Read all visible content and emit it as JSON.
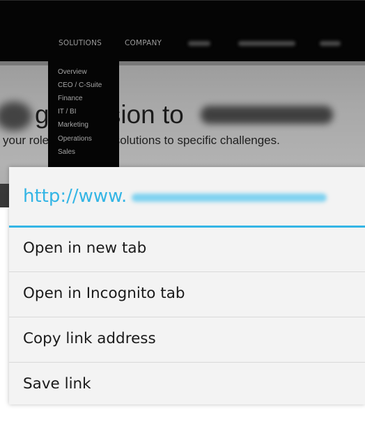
{
  "site": {
    "nav": {
      "solutions_label": "SOLUTIONS",
      "company_label": "COMPANY"
    },
    "dropdown_items": [
      "Overview",
      "CEO / C-Suite",
      "Finance",
      "IT / BI",
      "Marketing",
      "Operations",
      "Sales"
    ],
    "hero": {
      "heading": "give vision to",
      "subheading": "your role and unique solutions to specific challenges."
    }
  },
  "context_menu": {
    "url_prefix": "http://www.",
    "accent_color": "#33b5e5",
    "items": [
      "Open in new tab",
      "Open in Incognito tab",
      "Copy link address",
      "Save link"
    ]
  }
}
